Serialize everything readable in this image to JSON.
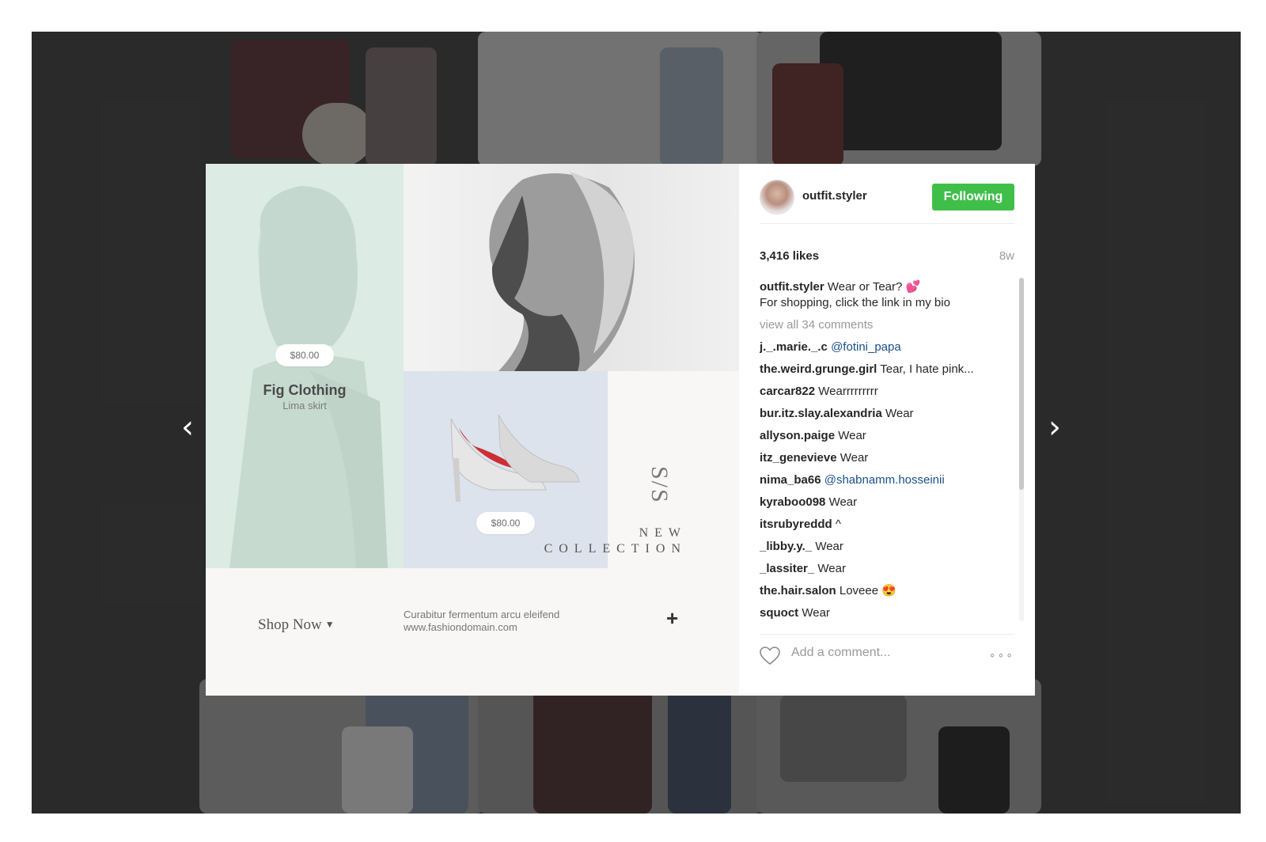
{
  "post": {
    "left_price": "$80.00",
    "brand": "Fig Clothing",
    "brand_sub": "Lima skirt",
    "shoe_price": "$80.00",
    "ss": "S/S",
    "new": "NEW",
    "collection": "COLLECTION",
    "shop_now": "Shop Now",
    "tagline_1": "Curabitur fermentum arcu eleifend",
    "tagline_2": "www.fashiondomain.com",
    "plus": "+"
  },
  "sidebar": {
    "username": "outfit.styler",
    "follow_label": "Following",
    "likes": "3,416 likes",
    "age": "8w",
    "caption_user": "outfit.styler",
    "caption_text": "Wear or Tear? 💕",
    "caption_line2": "For shopping, click the link in my bio",
    "view_all": "view all 34 comments",
    "comments": [
      {
        "user": "j._.marie._.c",
        "text": "@fotini_papa",
        "mention": true
      },
      {
        "user": "the.weird.grunge.girl",
        "text": "Tear, I hate pink..."
      },
      {
        "user": "carcar822",
        "text": "Wearrrrrrrrr"
      },
      {
        "user": "bur.itz.slay.alexandria",
        "text": "Wear"
      },
      {
        "user": "allyson.paige",
        "text": "Wear"
      },
      {
        "user": "itz_genevieve",
        "text": "Wear"
      },
      {
        "user": "nima_ba66",
        "text": "@shabnamm.hosseinii",
        "mention": true
      },
      {
        "user": "kyraboo098",
        "text": "Wear"
      },
      {
        "user": "itsrubyreddd",
        "text": "^"
      },
      {
        "user": "_libby.y._",
        "text": "Wear"
      },
      {
        "user": "_lassiter_",
        "text": "Wear"
      },
      {
        "user": "the.hair.salon",
        "text": "Loveee 😍"
      },
      {
        "user": "squoct",
        "text": "Wear"
      }
    ],
    "comment_placeholder": "Add a comment...",
    "more": "∘∘∘"
  },
  "nav": {
    "prev": "‹",
    "next": "›"
  },
  "colors": {
    "follow_green": "#3fbf4a",
    "mention_blue": "#1b4f8a"
  },
  "icons": {
    "heart": "heart-icon",
    "more": "more-options-icon",
    "prev": "chevron-left-icon",
    "next": "chevron-right-icon"
  }
}
